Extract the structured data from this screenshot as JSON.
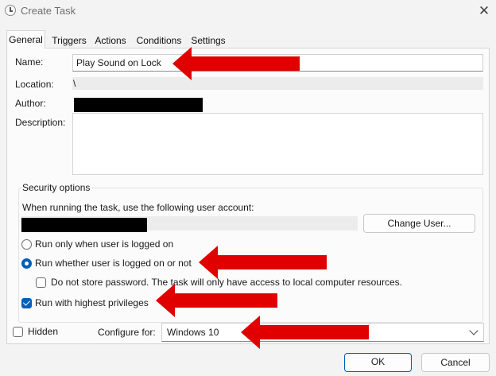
{
  "window": {
    "title": "Create Task",
    "close_glyph": "✕"
  },
  "tabs": [
    {
      "label": "General",
      "active": true
    },
    {
      "label": "Triggers"
    },
    {
      "label": "Actions"
    },
    {
      "label": "Conditions"
    },
    {
      "label": "Settings"
    }
  ],
  "general": {
    "name_label": "Name:",
    "name_value": "Play Sound on Lock",
    "location_label": "Location:",
    "location_value": "\\",
    "author_label": "Author:",
    "description_label": "Description:",
    "description_value": ""
  },
  "security": {
    "title": "Security options",
    "account_prompt": "When running the task, use the following user account:",
    "change_user_label": "Change User...",
    "run_logged_on_label": "Run only when user is logged on",
    "run_whether_label": "Run whether user is logged on or not",
    "no_store_password_label": "Do not store password.  The task will only have access to local computer resources.",
    "highest_privileges_label": "Run with highest privileges",
    "run_logged_on_selected": false,
    "run_whether_selected": true,
    "no_store_password_checked": false,
    "highest_privileges_checked": true
  },
  "bottom": {
    "hidden_label": "Hidden",
    "hidden_checked": false,
    "configure_label": "Configure for:",
    "configure_value": "Windows 10",
    "ok_label": "OK",
    "cancel_label": "Cancel"
  },
  "colors": {
    "accent": "#005fb8",
    "annotation_arrow": "#e00000"
  }
}
